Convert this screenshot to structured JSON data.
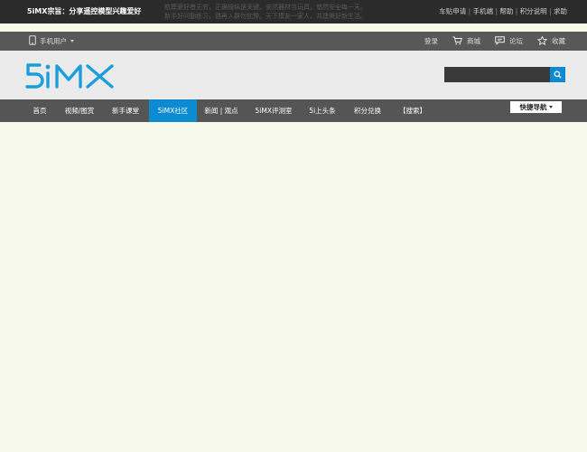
{
  "topbar": {
    "slogan": "5iMX宗旨：分享遥控模型兴趣爱好",
    "marquee_line1": "航模爱好者无穷，正确操纵是关键。安然器材当玩具，悠然安全每一天。",
    "marquee_line2": "新手好问勤练习，遇再入群勿犹豫。天下模友一家人，共建美好新生活。",
    "links": [
      "车贴申请",
      "手机端",
      "帮助",
      "积分说明",
      "求助"
    ]
  },
  "userbar": {
    "mobile_user": "手机用户",
    "login": "登录",
    "mall": "商城",
    "forum": "论坛",
    "favorite": "收藏"
  },
  "header": {
    "logo_text": "5iMX",
    "search_placeholder": ""
  },
  "nav": {
    "items": [
      {
        "label": "首页"
      },
      {
        "label": "视频/图赏"
      },
      {
        "label": "新手课堂"
      },
      {
        "label": "5iMX社区"
      },
      {
        "label": "新闻 | 观点"
      },
      {
        "label": "5iMX评测室"
      },
      {
        "label": "5i上头条"
      },
      {
        "label": "积分兑换"
      },
      {
        "label": "【搜索】"
      }
    ],
    "active_index": 3,
    "quick_nav": "快捷导航"
  },
  "colors": {
    "accent": "#0c8bd3",
    "topbar": "#2b2b2b",
    "navbar": "#555555",
    "background": "#f7f9eb"
  }
}
